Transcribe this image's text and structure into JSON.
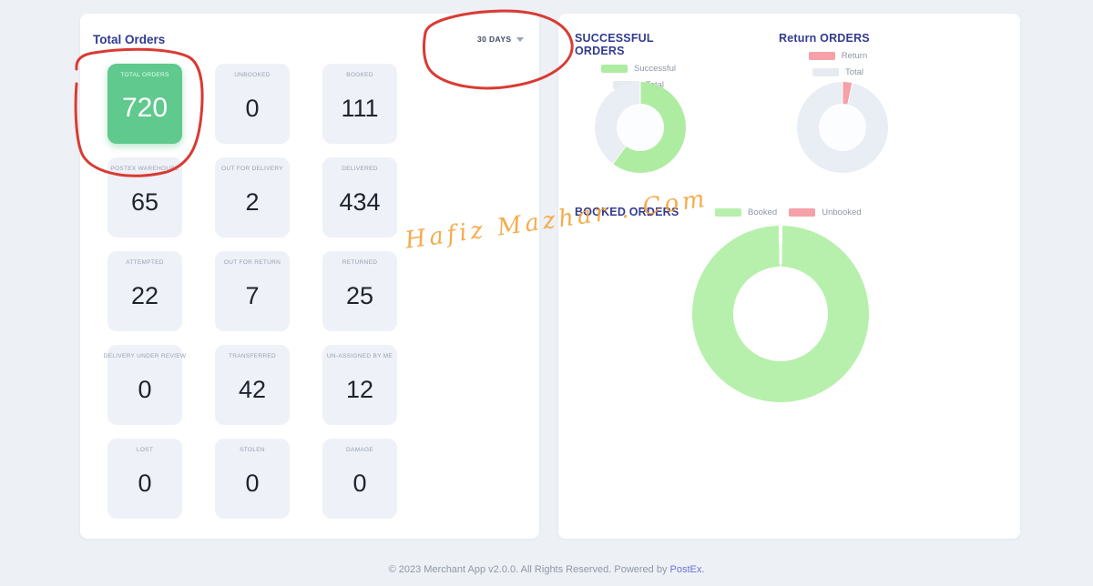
{
  "left_panel": {
    "title": "Total Orders",
    "period_selector": {
      "label": "30 DAYS",
      "icon": "chevron-down"
    },
    "cards": [
      {
        "label": "TOTAL ORDERS",
        "value": "720",
        "highlight": true
      },
      {
        "label": "UNBOOKED",
        "value": "0"
      },
      {
        "label": "BOOKED",
        "value": "111"
      },
      {
        "label": "POSTEX WAREHOUSE",
        "value": "65"
      },
      {
        "label": "OUT FOR DELIVERY",
        "value": "2"
      },
      {
        "label": "DELIVERED",
        "value": "434"
      },
      {
        "label": "ATTEMPTED",
        "value": "22"
      },
      {
        "label": "OUT FOR RETURN",
        "value": "7"
      },
      {
        "label": "RETURNED",
        "value": "25"
      },
      {
        "label": "DELIVERY UNDER REVIEW",
        "value": "0"
      },
      {
        "label": "TRANSFERRED",
        "value": "42"
      },
      {
        "label": "UN-ASSIGNED BY ME",
        "value": "12"
      },
      {
        "label": "LOST",
        "value": "0"
      },
      {
        "label": "STOLEN",
        "value": "0"
      },
      {
        "label": "DAMAGE",
        "value": "0"
      }
    ]
  },
  "chart_data": [
    {
      "id": "successful_orders",
      "type": "donut",
      "title": "SUCCESSFUL ORDERS",
      "legend_position": "top-center",
      "series": [
        {
          "name": "Successful",
          "value": 434,
          "color": "#aeeca2"
        },
        {
          "name": "Total",
          "value": 720,
          "color": "#e6eaf1"
        }
      ],
      "track_color": "#e9edf4",
      "shown_fraction_note": "green arc = Successful / Total = 0.60"
    },
    {
      "id": "return_orders",
      "type": "donut",
      "title": "Return ORDERS",
      "legend_position": "top-center",
      "series": [
        {
          "name": "Return",
          "value": 25,
          "color": "#f6a0a7"
        },
        {
          "name": "Total",
          "value": 720,
          "color": "#e6eaf1"
        }
      ],
      "track_color": "#e9edf4",
      "shown_fraction_note": "pink arc = Return / Total = 0.035"
    },
    {
      "id": "booked_orders",
      "type": "donut",
      "title": "BOOKED ORDERS",
      "legend_position": "right-of-title",
      "series": [
        {
          "name": "Booked",
          "value": 111,
          "color": "#b7f0ac"
        },
        {
          "name": "Unbooked",
          "value": 0,
          "color": "#f6a0a7"
        }
      ],
      "track_color": "#e9edf4",
      "shown_fraction_note": "donut fully green, Unbooked = 0"
    }
  ],
  "annotations": {
    "watermark_text": "Hafiz Mazhar . Com",
    "watermark_color": "#f5a53e",
    "circle_color": "#d93b33",
    "circled_elements": [
      "total-orders-card",
      "period-selector"
    ]
  },
  "footer": {
    "text": "© 2023 Merchant App v2.0.0. All Rights Reserved. Powered by ",
    "link_label": "PostEx."
  },
  "colors": {
    "background": "#edf0f5",
    "panel": "#ffffff",
    "card_background": "#eef1f7",
    "highlight_green": "#5fc98e",
    "donut_green": "#b7f0ac",
    "donut_pink": "#f6a0a7",
    "donut_track": "#e9edf4",
    "title_indigo": "#333b8f",
    "link_purple": "#6b74d8"
  }
}
